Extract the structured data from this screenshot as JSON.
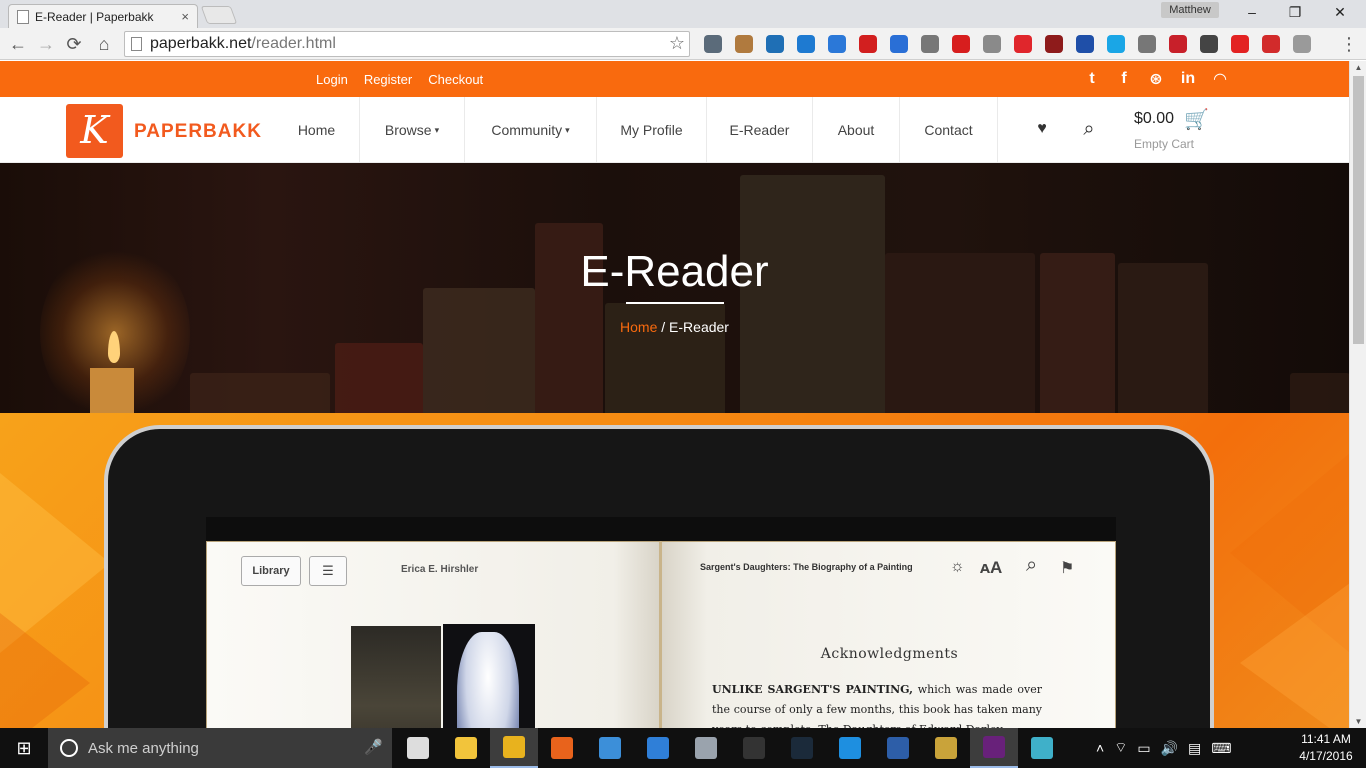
{
  "browser": {
    "tab_title": "E-Reader | Paperbakk",
    "tab_close": "×",
    "profile": "Matthew",
    "win_minimize": "–",
    "win_restore": "❐",
    "win_close": "✕",
    "url_domain": "paperbakk.net",
    "url_path": "/reader.html",
    "back": "←",
    "forward": "→",
    "reload": "⟳",
    "home": "⌂",
    "star": "☆",
    "menu": "⋮",
    "extensions": [
      {
        "name": "phone-ext-icon",
        "color": "#5b6b7a"
      },
      {
        "name": "cookie-ext-icon",
        "color": "#b07a3e"
      },
      {
        "name": "chat-ext-icon",
        "color": "#1f6fb5"
      },
      {
        "name": "network-ext-icon",
        "color": "#1e7ad1"
      },
      {
        "name": "download-ext-icon",
        "color": "#2b78d8"
      },
      {
        "name": "alert-ext-icon",
        "color": "#d21f1f"
      },
      {
        "name": "megaphone-ext-icon",
        "color": "#2a6fd6"
      },
      {
        "name": "film-ext-icon",
        "color": "#777777"
      },
      {
        "name": "adblock-ext-icon",
        "color": "#d71e1e"
      },
      {
        "name": "puzzle-ext-icon",
        "color": "#8a8a8a"
      },
      {
        "name": "opera-ext-icon",
        "color": "#e0262c"
      },
      {
        "name": "ublock-ext-icon",
        "color": "#8e1b1b"
      },
      {
        "name": "yapi-ext-icon",
        "color": "#1f4fa8"
      },
      {
        "name": "skype-ext-icon",
        "color": "#1aa6e6"
      },
      {
        "name": "power-ext-icon",
        "color": "#777777"
      },
      {
        "name": "fastforward-ext-icon",
        "color": "#c8202a"
      },
      {
        "name": "link-ext-icon",
        "color": "#444444"
      },
      {
        "name": "youtube-ext-icon",
        "color": "#e32222"
      },
      {
        "name": "timer-ext-icon",
        "color": "#d22b2b"
      },
      {
        "name": "user-ext-icon",
        "color": "#9a9a9a"
      }
    ]
  },
  "site": {
    "top_links": [
      "Login",
      "Register",
      "Checkout"
    ],
    "social": [
      {
        "name": "twitter-icon",
        "glyph": "t"
      },
      {
        "name": "facebook-icon",
        "glyph": "f"
      },
      {
        "name": "dribbble-icon",
        "glyph": "⊛"
      },
      {
        "name": "linkedin-icon",
        "glyph": "in"
      },
      {
        "name": "rss-icon",
        "glyph": "◠"
      }
    ],
    "logo_letter": "K",
    "logo_text": "PAPERBAKK",
    "nav": [
      {
        "label": "Home",
        "caret": "",
        "width": 86
      },
      {
        "label": "Browse",
        "caret": "▾",
        "width": 105
      },
      {
        "label": "Community",
        "caret": "▾",
        "width": 132
      },
      {
        "label": "My Profile",
        "caret": "",
        "width": 110
      },
      {
        "label": "E-Reader",
        "caret": "",
        "width": 106
      },
      {
        "label": "About",
        "caret": "",
        "width": 87
      },
      {
        "label": "Contact",
        "caret": "",
        "width": 98
      }
    ],
    "heart": "♥",
    "search": "⌕",
    "cart_amount": "$0.00",
    "cart_icon": "🛒",
    "cart_status": "Empty Cart",
    "hero_title": "E-Reader",
    "breadcrumb_home": "Home",
    "breadcrumb_sep": "/",
    "breadcrumb_current": "E-Reader",
    "brand_orange": "#f96a0e"
  },
  "reader": {
    "library_btn": "Library",
    "toc_btn": "☰",
    "author": "Erica E. Hirshler",
    "book_title": "Sargent's Daughters: The Biography of a Painting",
    "brightness_icon": "☼",
    "font_icon": "ᴀA",
    "search_icon": "⌕",
    "bookmark_icon": "⚑",
    "heading": "Acknowledgments",
    "para_lead": "UNLIKE SARGENT'S PAINTING,",
    "para_rest": " which was made over the course of only a few months, this book has taken many years to complete. The Daughters of Edward Darley"
  },
  "taskbar": {
    "start": "⊞",
    "search_placeholder": "Ask me anything",
    "mic": "🎤",
    "apps": [
      {
        "name": "task-view-icon",
        "color": "#dddddd",
        "active": false
      },
      {
        "name": "file-explorer-icon",
        "color": "#f2c43b",
        "active": false
      },
      {
        "name": "chrome-icon",
        "color": "#e8b21e",
        "active": true
      },
      {
        "name": "firefox-icon",
        "color": "#e8631c",
        "active": false
      },
      {
        "name": "control-panel-icon",
        "color": "#3c8fd9",
        "active": false
      },
      {
        "name": "clock-app-icon",
        "color": "#2f7fd8",
        "active": false
      },
      {
        "name": "remote-desktop-icon",
        "color": "#9aa3ad",
        "active": false
      },
      {
        "name": "terminal-icon",
        "color": "#333333",
        "active": false
      },
      {
        "name": "steam-icon",
        "color": "#1b2a3a",
        "active": false
      },
      {
        "name": "sync-app-icon",
        "color": "#1e8fe0",
        "active": false
      },
      {
        "name": "network-app-icon",
        "color": "#2d5ea8",
        "active": false
      },
      {
        "name": "tools-app-icon",
        "color": "#c9a33a",
        "active": false
      },
      {
        "name": "visual-studio-icon",
        "color": "#68217a",
        "active": true
      },
      {
        "name": "gear-app-icon",
        "color": "#3fb0c9",
        "active": false
      }
    ],
    "tray_icons": [
      "˄",
      "⌔",
      "▭",
      "🔊",
      "▤",
      "⌨"
    ],
    "time": "11:41 AM",
    "date": "4/17/2016"
  }
}
